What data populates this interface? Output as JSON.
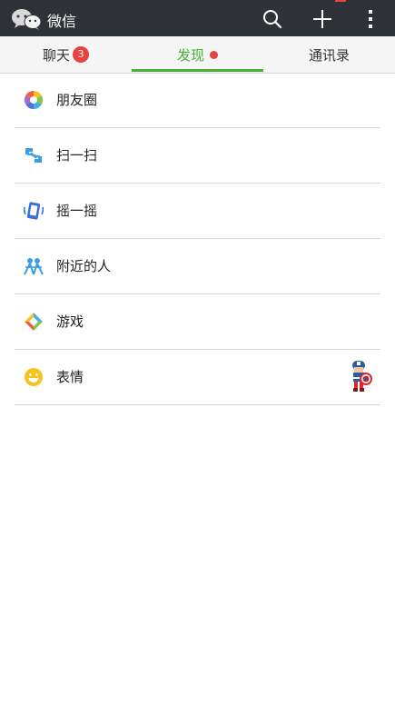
{
  "app": {
    "title": "微信"
  },
  "tabs": [
    {
      "label": "聊天",
      "badge": "3"
    },
    {
      "label": "发现",
      "dot": true
    },
    {
      "label": "通讯录"
    }
  ],
  "discover": {
    "items": [
      {
        "label": "朋友圈",
        "icon": "moments-icon"
      },
      {
        "label": "扫一扫",
        "icon": "scan-icon"
      },
      {
        "label": "摇一摇",
        "icon": "shake-icon"
      },
      {
        "label": "附近的人",
        "icon": "people-nearby-icon"
      },
      {
        "label": "游戏",
        "icon": "games-icon"
      },
      {
        "label": "表情",
        "icon": "sticker-icon"
      }
    ]
  },
  "colors": {
    "topbar": "#2f3236",
    "accent": "#45b035",
    "badge": "#e64340"
  }
}
